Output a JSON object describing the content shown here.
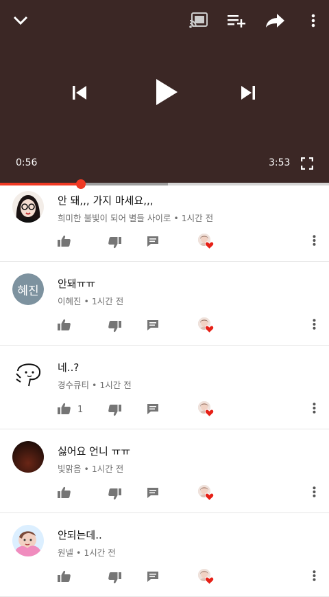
{
  "player": {
    "current_time": "0:56",
    "duration": "3:53",
    "progress": 0.245,
    "buffered": 0.51,
    "icons": [
      "chevron-down-icon",
      "cast-icon",
      "add-to-queue-icon",
      "share-icon",
      "more-vert-icon",
      "skip-previous-icon",
      "play-icon",
      "skip-next-icon",
      "fullscreen-icon"
    ]
  },
  "comments": [
    {
      "text": "안 돼,,, 가지 마세요,,,",
      "author": "희미한 불빛이 되어 별들 사이로",
      "time": "1시간 전",
      "likes": "",
      "avatar": "girl-glasses"
    },
    {
      "text": "안돼ㅠㅠ",
      "author": "이혜진",
      "time": "1시간 전",
      "likes": "",
      "avatar": "initials",
      "avatar_text": "혜진"
    },
    {
      "text": "네..?",
      "author": "경수큐티",
      "time": "1시간 전",
      "likes": "1",
      "avatar": "doodle"
    },
    {
      "text": "싫어요 언니 ㅠㅠ",
      "author": "빛맑음",
      "time": "1시간 전",
      "likes": "",
      "avatar": "dark"
    },
    {
      "text": "안되는데..",
      "author": "원넬",
      "time": "1시간 전",
      "likes": "",
      "avatar": "pink"
    }
  ],
  "colors": {
    "player_bg": "#3b2725",
    "accent": "#f03a24",
    "heart": "#e62117",
    "icon_gray": "#757575"
  }
}
